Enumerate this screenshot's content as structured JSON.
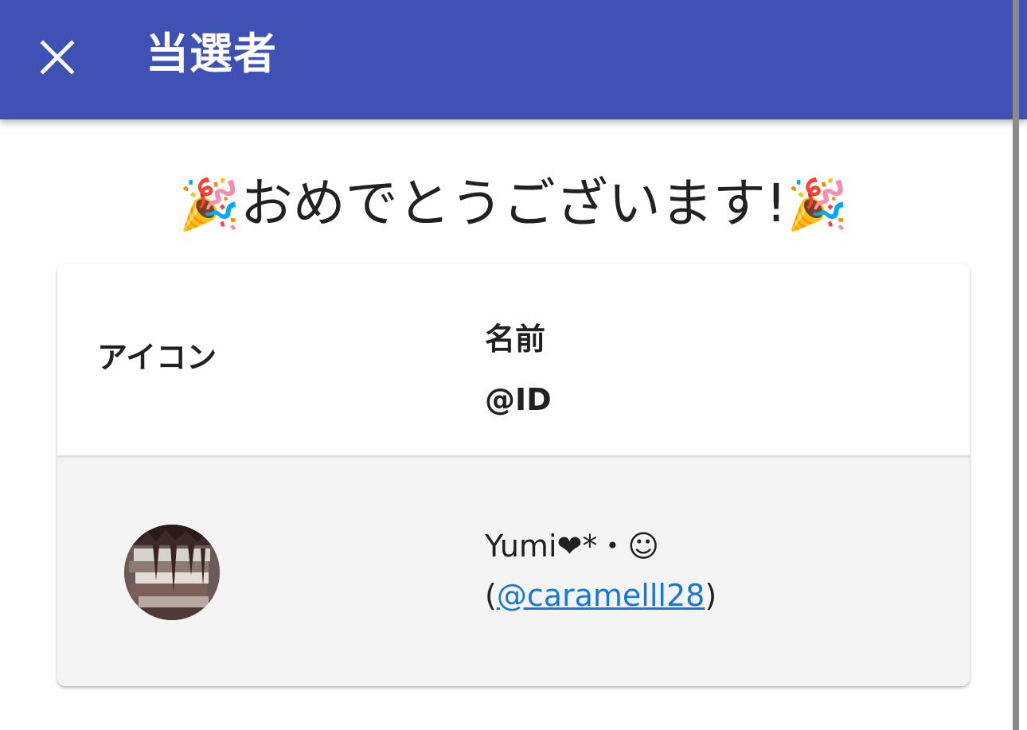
{
  "appbar": {
    "title": "当選者",
    "close_icon": "close-icon",
    "color": "#3f51b5"
  },
  "heading": {
    "emoji_left": "🎉",
    "text": "おめでとうございます!",
    "emoji_right": "🎉"
  },
  "table": {
    "columns": {
      "icon": "アイコン",
      "name": "名前",
      "id": "@ID"
    },
    "rows": [
      {
        "avatar": "user-avatar",
        "name": "Yumi❤*・☺",
        "id_open": "(",
        "id": "@caramelll28",
        "id_close": ")"
      }
    ]
  },
  "colors": {
    "link": "#1976d2",
    "row_bg": "#f4f4f4"
  }
}
